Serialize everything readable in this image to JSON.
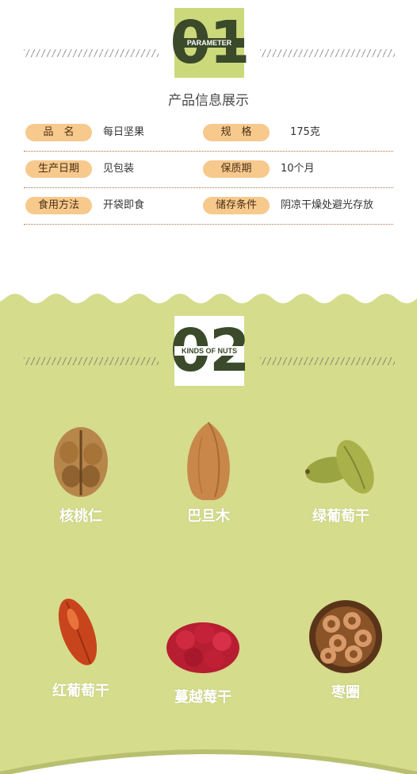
{
  "section1": {
    "badge_number": "01",
    "badge_tag": "PARAMETER",
    "title": "产品信息展示"
  },
  "params": [
    {
      "label_left": "品　名",
      "value_left": "每日坚果",
      "label_right": "规　格",
      "value_right": "175克"
    },
    {
      "label_left": "生产日期",
      "value_left": "见包装",
      "label_right": "保质期",
      "value_right": "10个月"
    },
    {
      "label_left": "食用方法",
      "value_left": "开袋即食",
      "label_right": "储存条件",
      "value_right": "阴凉干燥处避光存放"
    }
  ],
  "section2": {
    "badge_number": "02",
    "badge_tag": "KINDS OF NUTS"
  },
  "nuts": [
    {
      "label": "核桃仁",
      "icon": "walnut-icon"
    },
    {
      "label": "巴旦木",
      "icon": "almond-icon"
    },
    {
      "label": "绿葡萄干",
      "icon": "green-raisin-icon"
    },
    {
      "label": "红葡萄干",
      "icon": "red-raisin-icon"
    },
    {
      "label": "蔓越莓干",
      "icon": "cranberry-icon"
    },
    {
      "label": "枣圈",
      "icon": "jujube-ring-icon"
    }
  ],
  "colors": {
    "accent_green": "#ccd97a",
    "section_green": "#d5dc8c",
    "pill": "#f7c98c",
    "badge_text": "#3a4a2a"
  }
}
